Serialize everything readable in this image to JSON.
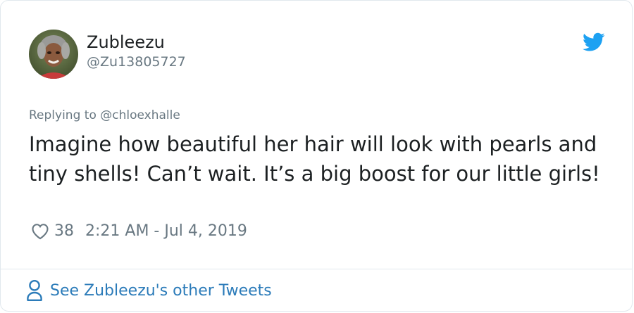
{
  "author": {
    "display_name": "Zubleezu",
    "handle": "@Zu13805727",
    "avatar_icon": "user-avatar"
  },
  "reply": {
    "prefix": "Replying to",
    "mention": "@chloexhalle"
  },
  "tweet": {
    "text": "Imagine how beautiful her hair will look with pearls and tiny shells! Can’t wait. It’s a big boost for our little girls!",
    "like_count": "38",
    "timestamp": "2:21 AM - Jul 4, 2019"
  },
  "footer": {
    "link_label": "See Zubleezu's other Tweets"
  },
  "colors": {
    "brand": "#1da1f2",
    "link": "#2b7bb9",
    "muted": "#697882",
    "text": "#1c2022",
    "border": "#e1e8ed"
  },
  "icons": {
    "brand": "twitter-bird-icon",
    "like": "heart-icon",
    "profile": "person-icon"
  }
}
